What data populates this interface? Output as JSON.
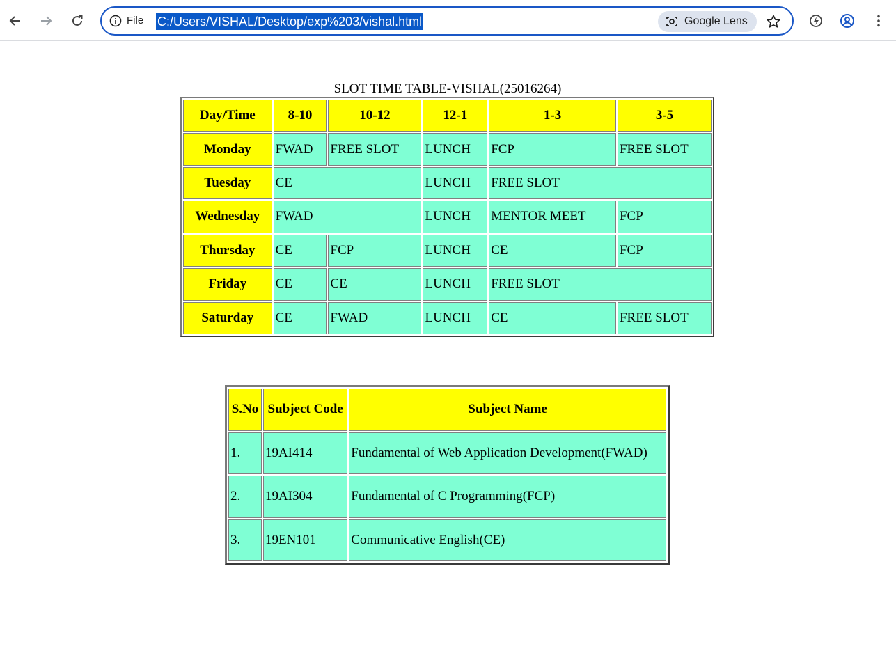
{
  "browser": {
    "file_label": "File",
    "url": "C:/Users/VISHAL/Desktop/exp%203/vishal.html",
    "lens_label": "Google Lens"
  },
  "timetable": {
    "caption": "SLOT TIME TABLE-VISHAL(25016264)",
    "headers": [
      "Day/Time",
      "8-10",
      "10-12",
      "12-1",
      "1-3",
      "3-5"
    ],
    "rows": [
      {
        "day": "Monday",
        "cells": [
          "FWAD",
          "FREE SLOT",
          "LUNCH",
          "FCP",
          "FREE SLOT"
        ]
      },
      {
        "day": "Tuesday",
        "cells": [
          "CE",
          "LUNCH",
          "FREE SLOT"
        ]
      },
      {
        "day": "Wednesday",
        "cells": [
          "FWAD",
          "LUNCH",
          "MENTOR MEET",
          "FCP"
        ]
      },
      {
        "day": "Thursday",
        "cells": [
          "CE",
          "FCP",
          "LUNCH",
          "CE",
          "FCP"
        ]
      },
      {
        "day": "Friday",
        "cells": [
          "CE",
          "CE",
          "LUNCH",
          "FREE SLOT"
        ]
      },
      {
        "day": "Saturday",
        "cells": [
          "CE",
          "FWAD",
          "LUNCH",
          "CE",
          "FREE SLOT"
        ]
      }
    ]
  },
  "subjects": {
    "headers": [
      "S.No",
      "Subject Code",
      "Subject Name"
    ],
    "rows": [
      {
        "sno": "1.",
        "code": "19AI414",
        "name": "Fundamental of Web Application Development(FWAD)"
      },
      {
        "sno": "2.",
        "code": "19AI304",
        "name": "Fundamental of C Programming(FCP)"
      },
      {
        "sno": "3.",
        "code": "19EN101",
        "name": "Communicative English(CE)"
      }
    ]
  },
  "colors": {
    "header_bg": "#ffff00",
    "cell_bg": "#7fffd4",
    "url_highlight": "#0a59c8",
    "omnibox_border": "#1a57c6"
  }
}
